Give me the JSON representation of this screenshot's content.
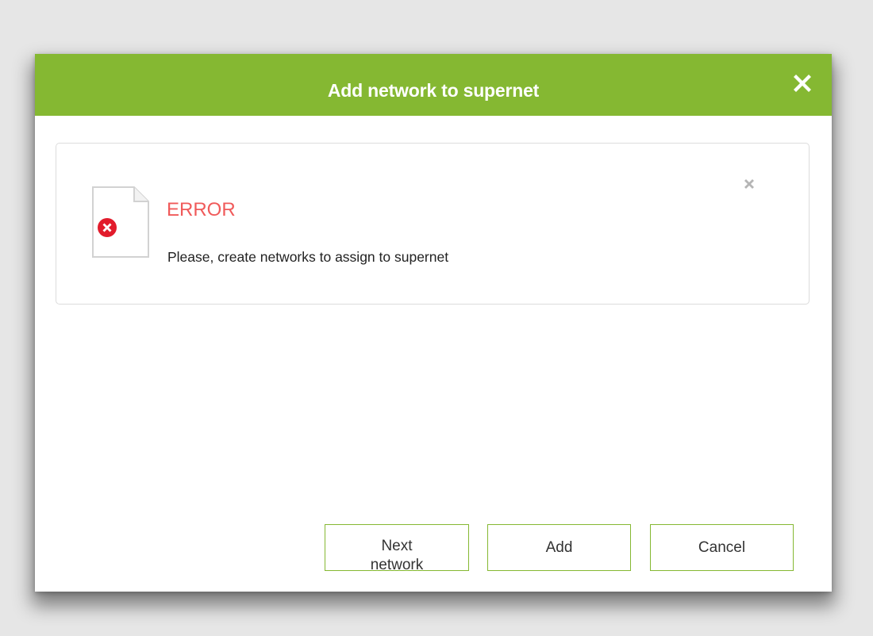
{
  "dialog": {
    "title": "Add network to supernet",
    "close_icon": "close-x-icon"
  },
  "alert": {
    "icon": "document-error-icon",
    "title": "ERROR",
    "message": "Please, create networks to assign to supernet",
    "close_icon": "close-x-icon"
  },
  "buttons": {
    "next_network": "Next network",
    "add": "Add",
    "cancel": "Cancel"
  },
  "colors": {
    "header": "#85b832",
    "error": "#f05a5a",
    "error_badge": "#e21c2c",
    "button_border": "#85b832"
  }
}
